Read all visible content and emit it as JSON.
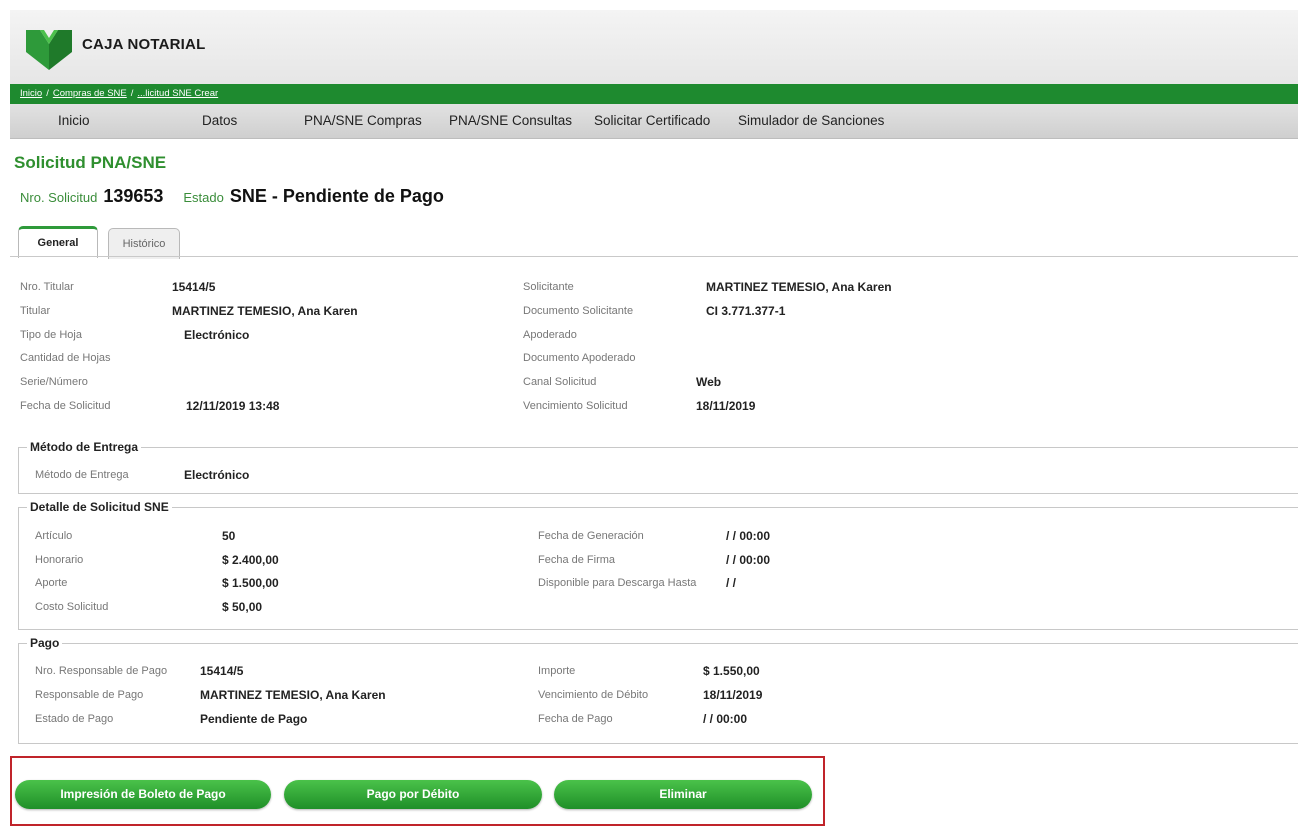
{
  "brand": {
    "name": "CAJA NOTARIAL",
    "color": "#1e8a2f"
  },
  "breadcrumb": [
    "Inicio",
    "Compras de SNE",
    "...licitud SNE Crear"
  ],
  "nav": [
    "Inicio",
    "Datos",
    "PNA/SNE Compras",
    "PNA/SNE Consultas",
    "Solicitar Certificado",
    "Simulador de Sanciones"
  ],
  "page": {
    "title": "Solicitud PNA/SNE",
    "request_number_label": "Nro. Solicitud",
    "request_number": "139653",
    "status_label": "Estado",
    "status": "SNE - Pendiente de Pago"
  },
  "tabs": [
    {
      "label": "General",
      "active": true
    },
    {
      "label": "Histórico",
      "active": false
    }
  ],
  "general": {
    "left": [
      {
        "label": "Nro. Titular",
        "value": "15414/5"
      },
      {
        "label": "Titular",
        "value": "MARTINEZ TEMESIO, Ana Karen"
      },
      {
        "label": "Tipo de Hoja",
        "value": "Electrónico"
      },
      {
        "label": "Cantidad de Hojas",
        "value": ""
      },
      {
        "label": "Serie/Número",
        "value": ""
      },
      {
        "label": "Fecha de Solicitud",
        "value": "12/11/2019 13:48"
      }
    ],
    "right": [
      {
        "label": "Solicitante",
        "value": "MARTINEZ TEMESIO, Ana Karen"
      },
      {
        "label": "Documento Solicitante",
        "value": "CI 3.771.377-1"
      },
      {
        "label": "Apoderado",
        "value": ""
      },
      {
        "label": "Documento Apoderado",
        "value": ""
      },
      {
        "label": "Canal Solicitud",
        "value": "Web"
      },
      {
        "label": "Vencimiento Solicitud",
        "value": "18/11/2019"
      }
    ]
  },
  "delivery": {
    "legend": "Método de Entrega",
    "label": "Método de Entrega",
    "value": "Electrónico"
  },
  "detail": {
    "legend": "Detalle de Solicitud SNE",
    "left": [
      {
        "label": "Artículo",
        "value": "50"
      },
      {
        "label": "Honorario",
        "value": "$ 2.400,00"
      },
      {
        "label": "Aporte",
        "value": "$ 1.500,00"
      },
      {
        "label": "Costo Solicitud",
        "value": "$ 50,00"
      }
    ],
    "right": [
      {
        "label": "Fecha de Generación",
        "value": "/ / 00:00"
      },
      {
        "label": "Fecha de Firma",
        "value": "/ / 00:00"
      },
      {
        "label": "Disponible para Descarga Hasta",
        "value": "/ /"
      }
    ]
  },
  "payment": {
    "legend": "Pago",
    "left": [
      {
        "label": "Nro. Responsable de Pago",
        "value": "15414/5"
      },
      {
        "label": "Responsable de Pago",
        "value": "MARTINEZ TEMESIO, Ana Karen"
      },
      {
        "label": "Estado de Pago",
        "value": "Pendiente de Pago"
      }
    ],
    "right": [
      {
        "label": "Importe",
        "value": "$ 1.550,00"
      },
      {
        "label": "Vencimiento de Débito",
        "value": "18/11/2019"
      },
      {
        "label": "Fecha de Pago",
        "value": "/ / 00:00"
      }
    ]
  },
  "actions": {
    "print_label": "Impresión de Boleto de Pago",
    "debit_label": "Pago por Débito",
    "delete_label": "Eliminar"
  }
}
